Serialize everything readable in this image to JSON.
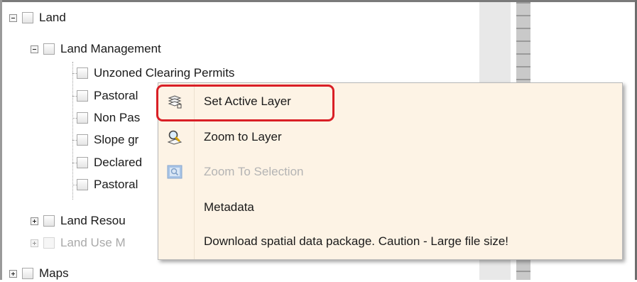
{
  "tree": {
    "land": {
      "label": "Land",
      "expanded": true
    },
    "land_management": {
      "label": "Land Management",
      "expanded": true,
      "children": [
        "Unzoned Clearing Permits",
        "Pastoral",
        "Non Pas",
        "Slope gr",
        "Declared",
        "Pastoral"
      ]
    },
    "land_resources": {
      "label": "Land Resou",
      "expanded": false
    },
    "land_use": {
      "label": "Land Use M",
      "expanded": false,
      "disabled": true
    },
    "maps": {
      "label": "Maps",
      "expanded": false
    }
  },
  "context_menu": {
    "items": [
      {
        "label": "Set Active Layer",
        "icon": "layers-icon",
        "disabled": false,
        "highlighted": true
      },
      {
        "label": "Zoom to Layer",
        "icon": "zoom-magnifier-icon",
        "disabled": false
      },
      {
        "label": "Zoom To Selection",
        "icon": "zoom-selection-icon",
        "disabled": true
      },
      {
        "label": "Metadata",
        "icon": "",
        "disabled": false
      },
      {
        "label": "Download spatial data package. Caution - Large file size!",
        "icon": "",
        "disabled": false
      }
    ]
  },
  "colors": {
    "menu_bg": "#fdf3e5",
    "highlight": "#d91f26",
    "disabled_text": "#b4b4b4"
  }
}
